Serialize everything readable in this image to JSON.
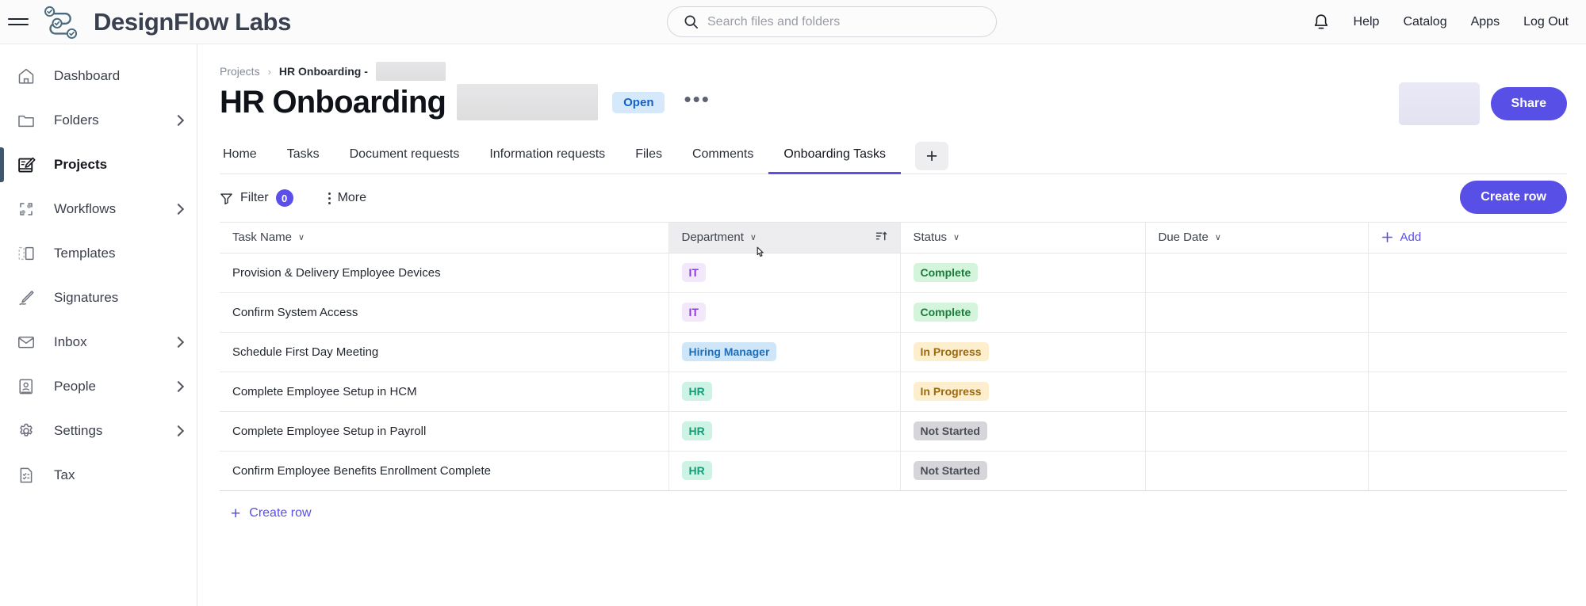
{
  "app": {
    "brand_name": "DesignFlow Labs",
    "logo_icon": "workflow-nodes-logo",
    "menu_icon": "hamburger-menu-icon"
  },
  "search": {
    "placeholder": "Search files and folders",
    "value": "",
    "icon": "search-icon"
  },
  "header": {
    "notifications_icon": "bell-icon",
    "links": [
      {
        "label": "Help",
        "name": "help"
      },
      {
        "label": "Catalog",
        "name": "catalog"
      },
      {
        "label": "Apps",
        "name": "apps"
      },
      {
        "label": "Log Out",
        "name": "log-out"
      }
    ]
  },
  "sidebar": {
    "items": [
      {
        "label": "Dashboard",
        "icon": "home-icon",
        "name": "dashboard",
        "active": false,
        "expandable": false
      },
      {
        "label": "Folders",
        "icon": "folder-icon",
        "name": "folders",
        "active": false,
        "expandable": true
      },
      {
        "label": "Projects",
        "icon": "projects-edit-icon",
        "name": "projects",
        "active": true,
        "expandable": false
      },
      {
        "label": "Workflows",
        "icon": "workflow-nodes-icon",
        "name": "workflows",
        "active": false,
        "expandable": true
      },
      {
        "label": "Templates",
        "icon": "template-icon",
        "name": "templates",
        "active": false,
        "expandable": false
      },
      {
        "label": "Signatures",
        "icon": "pen-signature-icon",
        "name": "signatures",
        "active": false,
        "expandable": false
      },
      {
        "label": "Inbox",
        "icon": "envelope-icon",
        "name": "inbox",
        "active": false,
        "expandable": true
      },
      {
        "label": "People",
        "icon": "person-card-icon",
        "name": "people",
        "active": false,
        "expandable": true
      },
      {
        "label": "Settings",
        "icon": "gear-icon",
        "name": "settings",
        "active": false,
        "expandable": true
      },
      {
        "label": "Tax",
        "icon": "tax-checklist-icon",
        "name": "tax",
        "active": false,
        "expandable": false
      }
    ]
  },
  "breadcrumb": {
    "root": "Projects",
    "separator": "›",
    "current": "HR Onboarding -",
    "redacted": true
  },
  "page": {
    "title": "HR Onboarding",
    "title_redacted": true,
    "status_badge": "Open",
    "overflow_menu": "•••",
    "share_label": "Share",
    "avatar_redacted": true
  },
  "tabs": {
    "items": [
      {
        "label": "Home",
        "name": "home",
        "active": false
      },
      {
        "label": "Tasks",
        "name": "tasks",
        "active": false
      },
      {
        "label": "Document requests",
        "name": "document-requests",
        "active": false
      },
      {
        "label": "Information requests",
        "name": "information-requests",
        "active": false
      },
      {
        "label": "Files",
        "name": "files",
        "active": false
      },
      {
        "label": "Comments",
        "name": "comments",
        "active": false
      },
      {
        "label": "Onboarding Tasks",
        "name": "onboarding-tasks",
        "active": true
      }
    ],
    "add_label": "+"
  },
  "toolbar": {
    "filter_label": "Filter",
    "filter_count": "0",
    "filter_icon": "funnel-icon",
    "more_label": "More",
    "more_icon": "vertical-dots-icon",
    "create_row_label": "Create row"
  },
  "table": {
    "columns": [
      {
        "label": "Task Name",
        "name": "task-name",
        "caret": "∨",
        "hovered": false,
        "sortable": false
      },
      {
        "label": "Department",
        "name": "department",
        "caret": "∨",
        "hovered": true,
        "sortable": true,
        "sort_icon": "sort-ascending-icon"
      },
      {
        "label": "Status",
        "name": "status",
        "caret": "∨",
        "hovered": false,
        "sortable": false
      },
      {
        "label": "Due Date",
        "name": "due-date",
        "caret": "∨",
        "hovered": false,
        "sortable": false
      }
    ],
    "add_column_label": "Add",
    "rows": [
      {
        "task": "Provision & Delivery Employee Devices",
        "department": "IT",
        "dept_style": "it",
        "status": "Complete",
        "status_style": "complete",
        "due_date": ""
      },
      {
        "task": "Confirm System Access",
        "department": "IT",
        "dept_style": "it",
        "status": "Complete",
        "status_style": "complete",
        "due_date": ""
      },
      {
        "task": "Schedule First Day Meeting",
        "department": "Hiring Manager",
        "dept_style": "hm",
        "status": "In Progress",
        "status_style": "inprogress",
        "due_date": ""
      },
      {
        "task": "Complete Employee Setup in HCM",
        "department": "HR",
        "dept_style": "hr",
        "status": "In Progress",
        "status_style": "inprogress",
        "due_date": ""
      },
      {
        "task": "Complete Employee Setup in Payroll",
        "department": "HR",
        "dept_style": "hr",
        "status": "Not Started",
        "status_style": "notstarted",
        "due_date": ""
      },
      {
        "task": "Confirm Employee Benefits Enrollment Complete",
        "department": "HR",
        "dept_style": "hr",
        "status": "Not Started",
        "status_style": "notstarted",
        "due_date": ""
      }
    ],
    "footer_create_row_label": "Create row"
  },
  "colors": {
    "accent_indigo": "#574fe6",
    "brand_navy": "#39404f",
    "status_open_bg": "#d6e9fb",
    "status_open_text": "#1161c9",
    "pill_it_bg": "#f3e7fb",
    "pill_hiring_manager_bg": "#cfe6f9",
    "pill_hr_bg": "#cdf3e4",
    "pill_complete_bg": "#d4f5dc",
    "pill_inprogress_bg": "#fdeecd",
    "pill_notstarted_bg": "#d6d6da"
  }
}
